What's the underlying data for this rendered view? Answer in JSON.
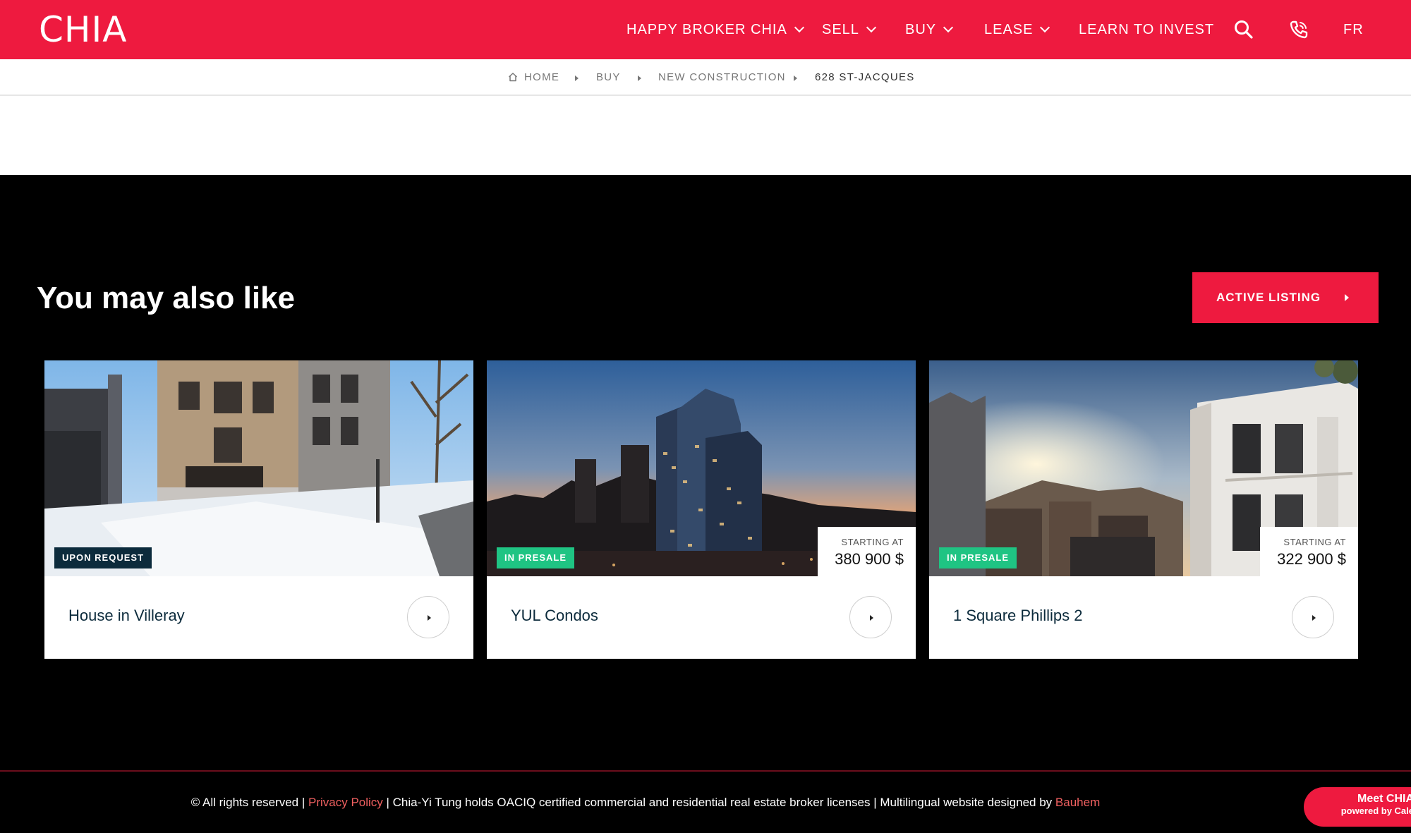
{
  "header": {
    "logo": "CHIA",
    "nav": [
      {
        "label": "HAPPY BROKER CHIA",
        "has_dropdown": true
      },
      {
        "label": "SELL",
        "has_dropdown": true
      },
      {
        "label": "BUY",
        "has_dropdown": true
      },
      {
        "label": "LEASE",
        "has_dropdown": true
      },
      {
        "label": "LEARN TO INVEST",
        "has_dropdown": false
      }
    ],
    "icons": [
      "search-icon",
      "phone-icon"
    ],
    "lang": "FR"
  },
  "breadcrumb": {
    "items": [
      "HOME",
      "BUY",
      "NEW CONSTRUCTION",
      "628 ST-JACQUES"
    ],
    "home_icon": "home-icon"
  },
  "section": {
    "title": "You may also like",
    "cta_label": "ACTIVE LISTING"
  },
  "cards": [
    {
      "title": "House in Villeray",
      "badge": "UPON REQUEST",
      "badge_color": "#0c2b3c"
    },
    {
      "title": "YUL Condos",
      "badge": "IN PRESALE",
      "badge_color": "#1fc483",
      "price_label": "STARTING AT",
      "price": "380 900 $"
    },
    {
      "title": "1 Square Phillips 2",
      "badge": "IN PRESALE",
      "badge_color": "#1fc483",
      "price_label": "STARTING AT",
      "price": "322 900 $"
    }
  ],
  "footer": {
    "copyright": "© All rights reserved | ",
    "privacy_link": "Privacy Policy",
    "middle": " | Chia-Yi Tung holds OACIQ certified commercial and residential real estate broker licenses | Multilingual website designed by ",
    "designer_link": "Bauhem"
  },
  "chat_widget": {
    "line1": "Meet CHIA",
    "line2": "powered by Cale"
  },
  "colors": {
    "brand_red": "#ee1a3f",
    "navy": "#0c2b3c",
    "presale_green": "#1fc483"
  }
}
